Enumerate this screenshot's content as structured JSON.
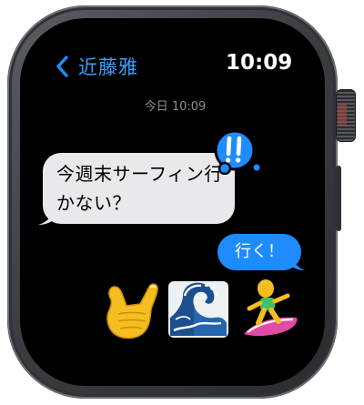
{
  "header": {
    "contact_name": "近藤雅",
    "time": "10:09"
  },
  "conversation": {
    "timestamp": "今日 10:09",
    "incoming_message": "今週末サーフィン行かない？",
    "outgoing_message": "行く！",
    "tapback": "exclamation-tapback-icon",
    "emoji_reply": [
      "call-me-hand-emoji",
      "water-wave-emoji",
      "person-surfing-emoji"
    ]
  },
  "colors": {
    "accent_blue": "#1e8cff",
    "incoming_bubble": "#e9e9eb",
    "screen_background": "#000000",
    "timestamp_gray": "#8e8e93"
  }
}
